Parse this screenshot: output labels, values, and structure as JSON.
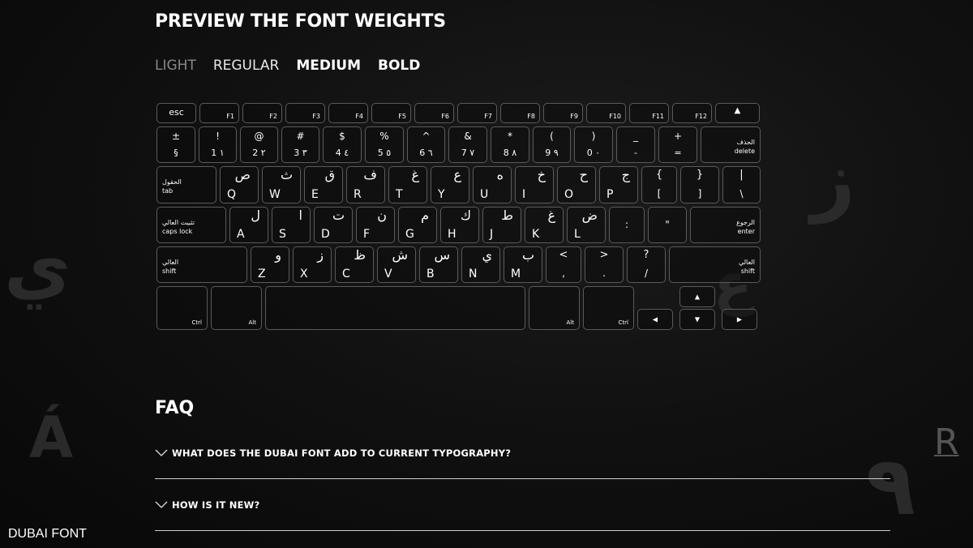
{
  "page_title": "PREVIEW THE FONT WEIGHTS",
  "weights": [
    "LIGHT",
    "REGULAR",
    "MEDIUM",
    "BOLD"
  ],
  "background_glyphs": [
    "ي",
    "ز",
    "ع",
    "Á",
    "٩"
  ],
  "trademark_mark": "R",
  "keyboard": {
    "function_row": [
      "esc",
      "F1",
      "F2",
      "F3",
      "F4",
      "F5",
      "F6",
      "F7",
      "F8",
      "F9",
      "F10",
      "F11",
      "F12",
      "▲"
    ],
    "number_row": [
      {
        "top": "±",
        "bottom": "§"
      },
      {
        "top": "!",
        "bottom": "1 ١"
      },
      {
        "top": "@",
        "bottom": "2 ٢"
      },
      {
        "top": "#",
        "bottom": "3 ٣"
      },
      {
        "top": "$",
        "bottom": "4 ٤"
      },
      {
        "top": "%",
        "bottom": "5 ٥"
      },
      {
        "top": "^",
        "bottom": "6 ٦"
      },
      {
        "top": "&",
        "bottom": "7 ٧"
      },
      {
        "top": "*",
        "bottom": "8 ٨"
      },
      {
        "top": "(",
        "bottom": "9 ٩"
      },
      {
        "top": ")",
        "bottom": "0 ٠"
      },
      {
        "top": "_",
        "bottom": "-"
      },
      {
        "top": "+",
        "bottom": "="
      }
    ],
    "delete": {
      "ar": "الحذف",
      "en": "delete"
    },
    "tab": {
      "ar": "الحقول",
      "en": "tab"
    },
    "qwerty_row": [
      {
        "en": "Q",
        "ar": "ص"
      },
      {
        "en": "W",
        "ar": "ث"
      },
      {
        "en": "E",
        "ar": "ق"
      },
      {
        "en": "R",
        "ar": "ف"
      },
      {
        "en": "T",
        "ar": "غ"
      },
      {
        "en": "Y",
        "ar": "ع"
      },
      {
        "en": "U",
        "ar": "ه"
      },
      {
        "en": "I",
        "ar": "خ"
      },
      {
        "en": "O",
        "ar": "ح"
      },
      {
        "en": "P",
        "ar": "ج"
      }
    ],
    "qwerty_row_extra": [
      {
        "top": "{",
        "bottom": "["
      },
      {
        "top": "}",
        "bottom": "]"
      },
      {
        "top": "|",
        "bottom": "\\"
      }
    ],
    "caps_lock": {
      "ar": "تثبيت العالي",
      "en": "caps lock"
    },
    "home_row": [
      {
        "en": "A",
        "ar": "ل"
      },
      {
        "en": "S",
        "ar": "ا"
      },
      {
        "en": "D",
        "ar": "ت"
      },
      {
        "en": "F",
        "ar": "ن"
      },
      {
        "en": "G",
        "ar": "م"
      },
      {
        "en": "H",
        "ar": "ك"
      },
      {
        "en": "J",
        "ar": "ط"
      },
      {
        "en": "K",
        "ar": "غ"
      },
      {
        "en": "L",
        "ar": "ض"
      }
    ],
    "home_row_extra": [
      ":",
      "\""
    ],
    "enter": {
      "ar": "الرجوع",
      "en": "enter"
    },
    "shift_left": {
      "ar": "العالي",
      "en": "shift"
    },
    "bottom_row": [
      {
        "en": "Z",
        "ar": "و"
      },
      {
        "en": "X",
        "ar": "ز"
      },
      {
        "en": "C",
        "ar": "ظ"
      },
      {
        "en": "V",
        "ar": "ش"
      },
      {
        "en": "B",
        "ar": "س"
      },
      {
        "en": "N",
        "ar": "ي"
      },
      {
        "en": "M",
        "ar": "ب"
      }
    ],
    "bottom_row_extra": [
      {
        "top": "<",
        "bottom": ","
      },
      {
        "top": ">",
        "bottom": "."
      },
      {
        "top": "?",
        "bottom": "/"
      }
    ],
    "shift_right": {
      "ar": "العالي",
      "en": "shift"
    },
    "space_row": [
      "Ctrl",
      "Alt",
      "Alt",
      "Ctrl"
    ],
    "arrows": [
      "▲",
      "◀",
      "▼",
      "▶"
    ]
  },
  "faq": {
    "title": "FAQ",
    "items": [
      "WHAT DOES THE DUBAI FONT ADD TO CURRENT TYPOGRAPHY?",
      "HOW IS IT NEW?"
    ]
  },
  "footer_brand": "DUBAI FONT"
}
